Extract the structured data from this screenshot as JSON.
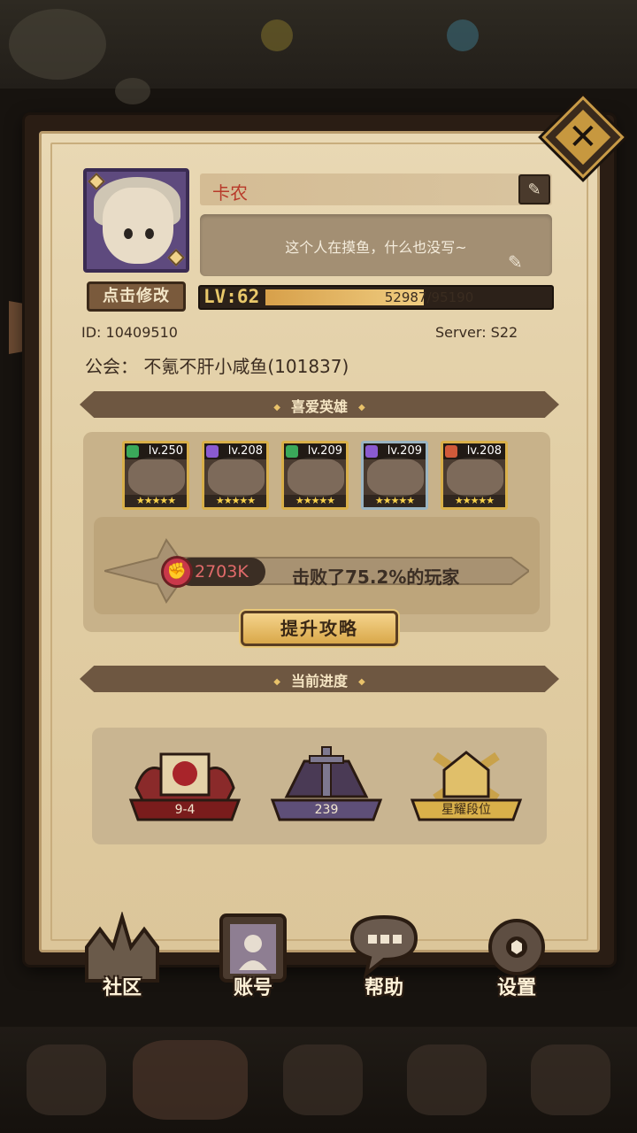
{
  "profile": {
    "name": "卡农",
    "signature": "这个人在摸鱼，什么也没写~",
    "edit_avatar_label": "点击修改",
    "level_label": "LV:62",
    "exp_text": "52987/95190",
    "exp_fraction": 0.5567,
    "id_text": "ID:  10409510",
    "server_text": "Server:  S22",
    "guild_text": "公会：  不氪不肝小咸鱼(101837)"
  },
  "favorite_heroes": {
    "title": "喜爱英雄",
    "heroes": [
      {
        "level": "lv.250",
        "element_color": "#3aa85a",
        "frame_color": "#d9b04a"
      },
      {
        "level": "lv.208",
        "element_color": "#8a5ad0",
        "frame_color": "#d9b04a"
      },
      {
        "level": "lv.209",
        "element_color": "#3aa85a",
        "frame_color": "#d9b04a"
      },
      {
        "level": "lv.209",
        "element_color": "#8a5ad0",
        "frame_color": "#9ab4c2"
      },
      {
        "level": "lv.208",
        "element_color": "#d05a3a",
        "frame_color": "#d9b04a"
      }
    ],
    "power": "2703K",
    "defeat_text": "击败了75.2%的玩家",
    "strategy_button": "提升攻略"
  },
  "progress": {
    "title": "当前进度",
    "items": [
      {
        "badge": "9-4",
        "icon": "campaign-book-icon"
      },
      {
        "badge": "239",
        "icon": "tower-swords-icon"
      },
      {
        "badge": "星耀段位",
        "icon": "arena-rank-icon"
      }
    ]
  },
  "nav": {
    "community": "社区",
    "account": "账号",
    "help": "帮助",
    "settings": "设置"
  },
  "colors": {
    "panel": "#e2cfa6",
    "accent_gold": "#d9b04a",
    "name_red": "#b83a2a"
  }
}
